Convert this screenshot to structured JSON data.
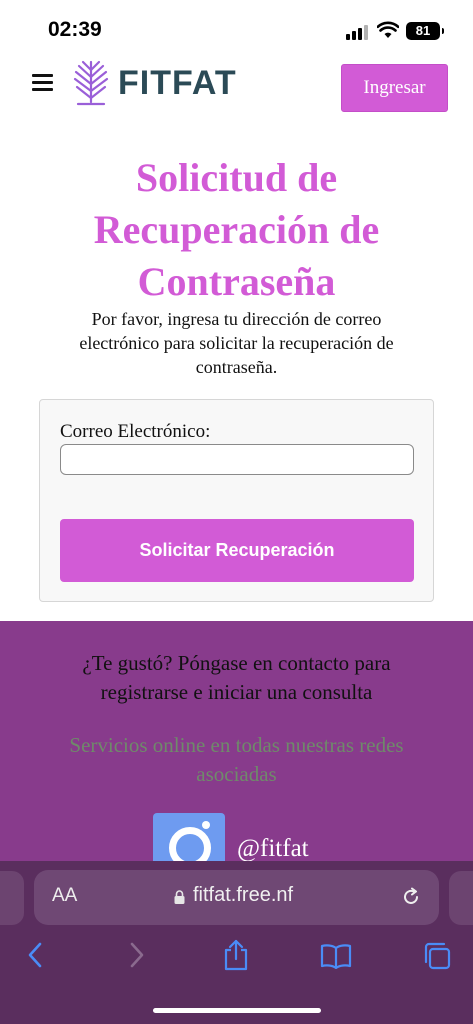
{
  "status_bar": {
    "time": "02:39",
    "battery": "81"
  },
  "header": {
    "brand": "FITFAT",
    "login_label": "Ingresar",
    "brand_color": "#2b4a56",
    "accent_color": "#d25bd6"
  },
  "main": {
    "title": "Solicitud de Recuperación de Contraseña",
    "intro": "Por favor, ingresa tu dirección de correo electrónico para solicitar la recuperación de contraseña.",
    "form": {
      "email_label": "Correo Electrónico:",
      "email_value": "",
      "submit_label": "Solicitar Recuperación"
    }
  },
  "footer": {
    "cta": "¿Te gustó? Póngase en contacto para registrarse e iniciar una consulta",
    "services": "Servicios online en todas nuestras redes asociadas",
    "social_handle": "@fitfat",
    "background_color": "#883b8c"
  },
  "browser": {
    "aa_label": "AA",
    "url": "fitfat.free.nf",
    "icons": [
      "back-icon",
      "forward-icon",
      "share-icon",
      "bookmarks-icon",
      "tabs-icon"
    ]
  }
}
